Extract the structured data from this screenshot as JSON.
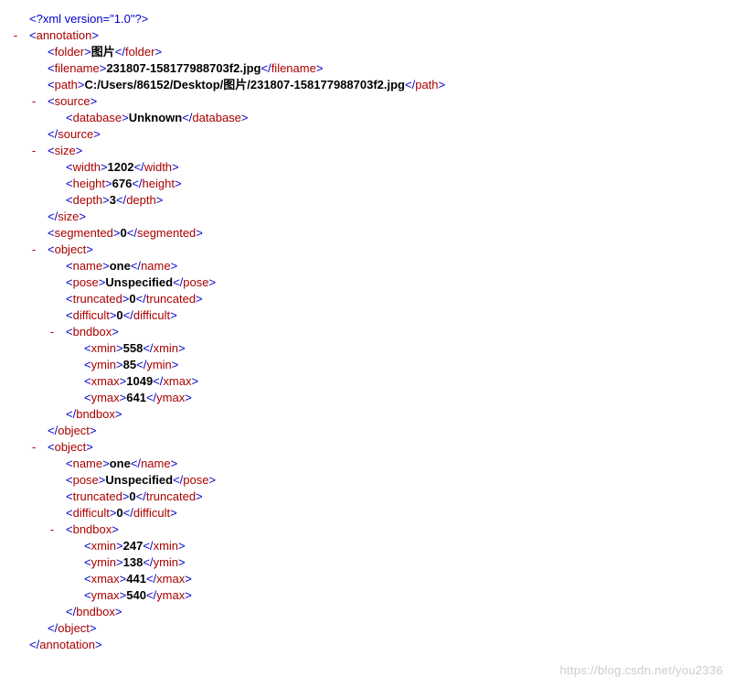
{
  "watermark": "https://blog.csdn.net/you2336",
  "xml": {
    "pi": "<?xml version=\"1.0\"?>",
    "annotation_open": "annotation",
    "folder": {
      "tag": "folder",
      "value": "图片"
    },
    "filename": {
      "tag": "filename",
      "value": "231807-158177988703f2.jpg"
    },
    "path": {
      "tag": "path",
      "value": "C:/Users/86152/Desktop/图片/231807-158177988703f2.jpg"
    },
    "source": {
      "tag": "source",
      "database": {
        "tag": "database",
        "value": "Unknown"
      }
    },
    "size": {
      "tag": "size",
      "width": {
        "tag": "width",
        "value": "1202"
      },
      "height": {
        "tag": "height",
        "value": "676"
      },
      "depth": {
        "tag": "depth",
        "value": "3"
      }
    },
    "segmented": {
      "tag": "segmented",
      "value": "0"
    },
    "object1": {
      "tag": "object",
      "name": {
        "tag": "name",
        "value": "one"
      },
      "pose": {
        "tag": "pose",
        "value": "Unspecified"
      },
      "truncated": {
        "tag": "truncated",
        "value": "0"
      },
      "difficult": {
        "tag": "difficult",
        "value": "0"
      },
      "bndbox": {
        "tag": "bndbox",
        "xmin": {
          "tag": "xmin",
          "value": "558"
        },
        "ymin": {
          "tag": "ymin",
          "value": "85"
        },
        "xmax": {
          "tag": "xmax",
          "value": "1049"
        },
        "ymax": {
          "tag": "ymax",
          "value": "641"
        }
      }
    },
    "object2": {
      "tag": "object",
      "name": {
        "tag": "name",
        "value": "one"
      },
      "pose": {
        "tag": "pose",
        "value": "Unspecified"
      },
      "truncated": {
        "tag": "truncated",
        "value": "0"
      },
      "difficult": {
        "tag": "difficult",
        "value": "0"
      },
      "bndbox": {
        "tag": "bndbox",
        "xmin": {
          "tag": "xmin",
          "value": "247"
        },
        "ymin": {
          "tag": "ymin",
          "value": "138"
        },
        "xmax": {
          "tag": "xmax",
          "value": "441"
        },
        "ymax": {
          "tag": "ymax",
          "value": "540"
        }
      }
    }
  }
}
